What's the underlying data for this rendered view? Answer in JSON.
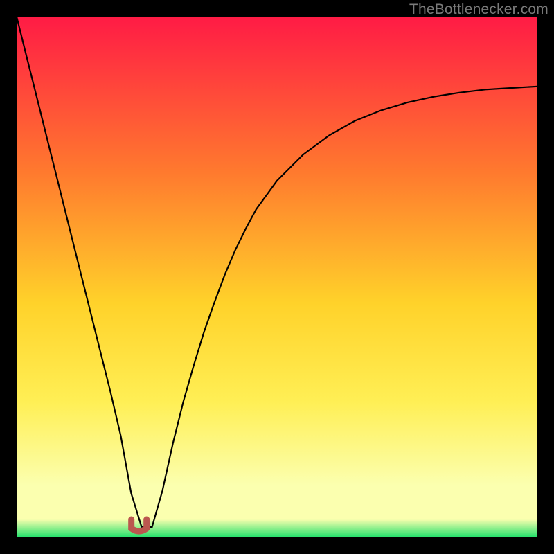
{
  "watermark": "TheBottlenecker.com",
  "colors": {
    "top": "#ff1b45",
    "mid_upper": "#ff7a2e",
    "mid": "#ffd22a",
    "mid_lower": "#ffef55",
    "pale": "#fbffaf",
    "bottom": "#1fe06a",
    "curve": "#000000",
    "marker": "#bb574f",
    "frame_bg": "#000000"
  },
  "chart_data": {
    "type": "line",
    "title": "",
    "xlabel": "",
    "ylabel": "",
    "x": [
      0.0,
      0.02,
      0.04,
      0.06,
      0.08,
      0.1,
      0.12,
      0.14,
      0.16,
      0.18,
      0.2,
      0.22,
      0.24,
      0.26,
      0.28,
      0.3,
      0.32,
      0.34,
      0.36,
      0.38,
      0.4,
      0.42,
      0.44,
      0.46,
      0.5,
      0.55,
      0.6,
      0.65,
      0.7,
      0.75,
      0.8,
      0.85,
      0.9,
      0.95,
      1.0
    ],
    "y": [
      1.0,
      0.92,
      0.84,
      0.76,
      0.68,
      0.6,
      0.52,
      0.44,
      0.36,
      0.28,
      0.195,
      0.085,
      0.02,
      0.02,
      0.09,
      0.18,
      0.26,
      0.33,
      0.395,
      0.452,
      0.505,
      0.552,
      0.593,
      0.63,
      0.685,
      0.735,
      0.772,
      0.8,
      0.82,
      0.835,
      0.846,
      0.854,
      0.86,
      0.863,
      0.866
    ],
    "xlim": [
      0,
      1
    ],
    "ylim": [
      0,
      1
    ],
    "marker": {
      "x": 0.235,
      "y": 0.02
    },
    "gradient_stops": [
      {
        "offset": 0.0,
        "y_norm": 1.0
      },
      {
        "offset": 0.3,
        "y_norm": 0.7
      },
      {
        "offset": 0.55,
        "y_norm": 0.45
      },
      {
        "offset": 0.74,
        "y_norm": 0.26
      },
      {
        "offset": 0.9,
        "y_norm": 0.1
      },
      {
        "offset": 0.965,
        "y_norm": 0.035
      },
      {
        "offset": 1.0,
        "y_norm": 0.0
      }
    ]
  }
}
